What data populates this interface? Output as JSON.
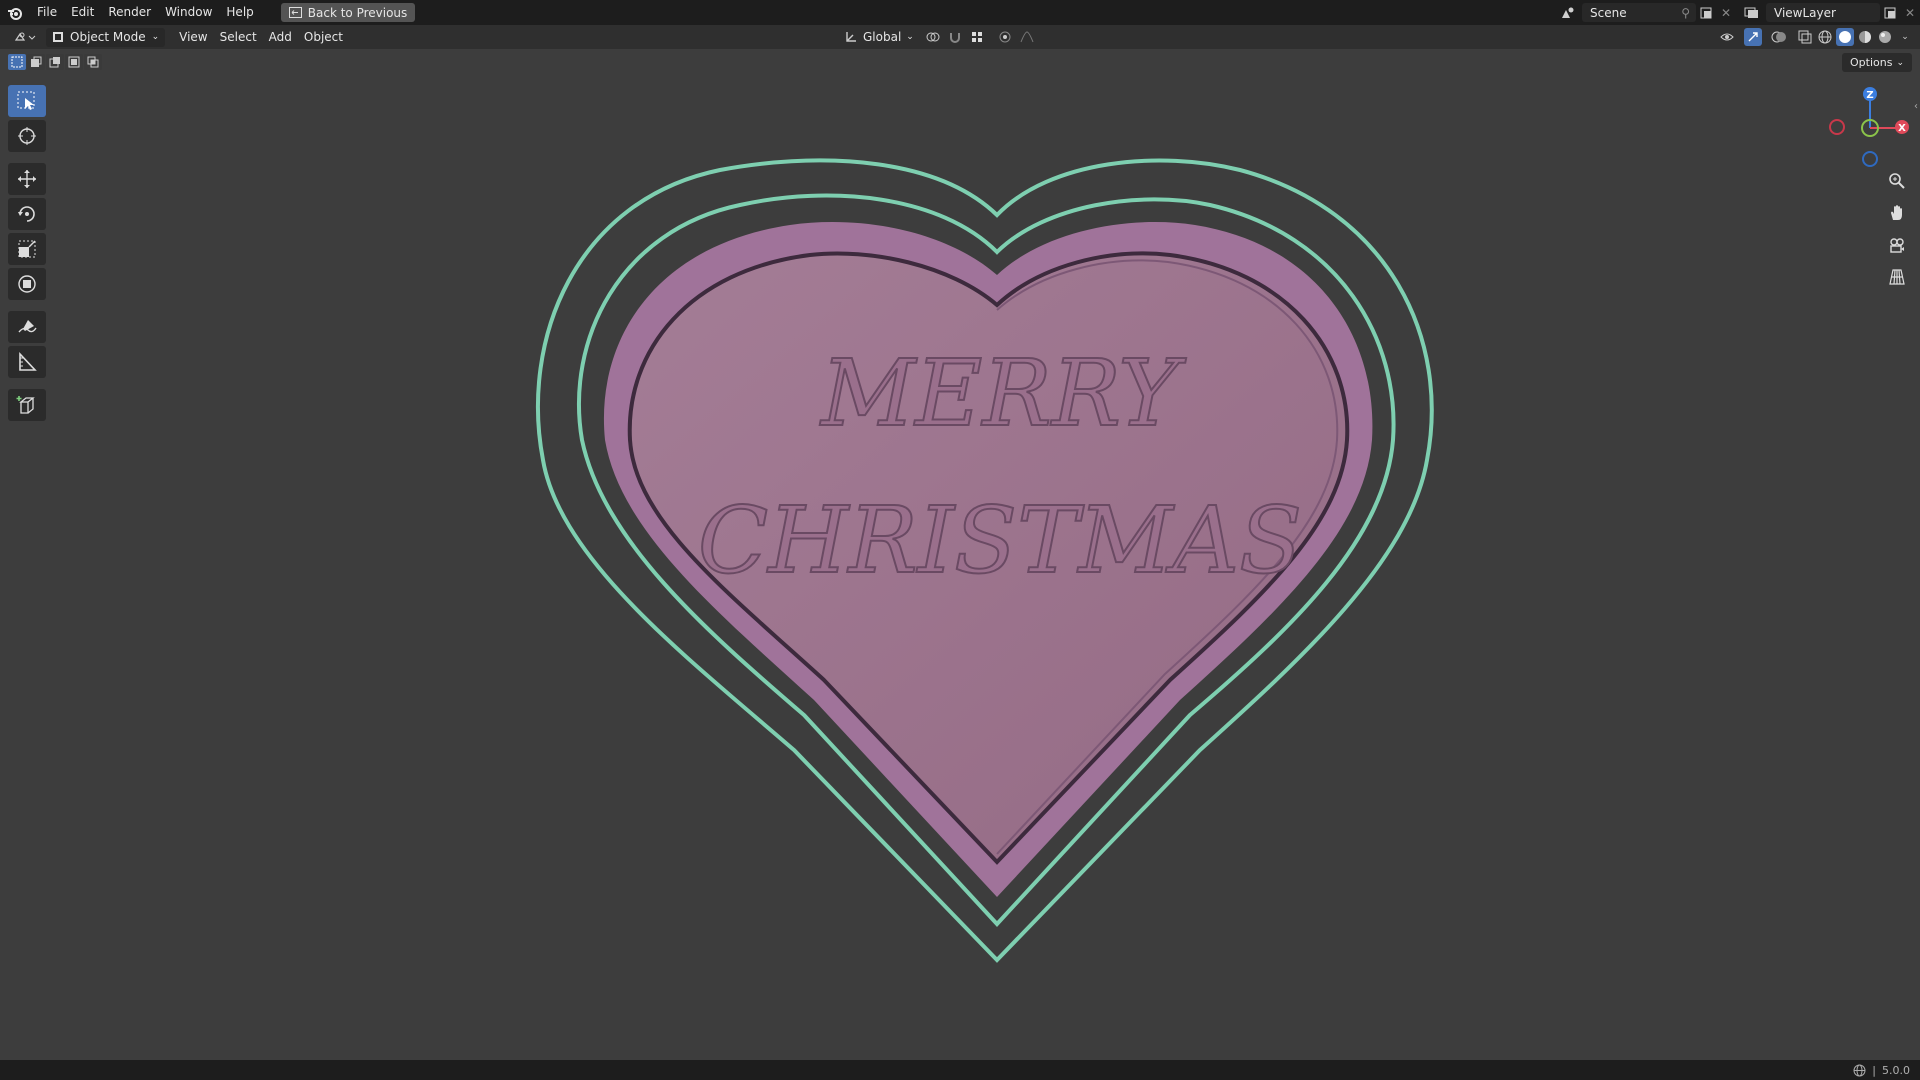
{
  "topbar": {
    "menus": [
      "File",
      "Edit",
      "Render",
      "Window",
      "Help"
    ],
    "back_label": "Back to Previous",
    "scene": "Scene",
    "view_layer": "ViewLayer"
  },
  "viewport_header": {
    "mode": "Object Mode",
    "menus": [
      "View",
      "Select",
      "Add",
      "Object"
    ],
    "transform_orientation": "Global",
    "options": "Options"
  },
  "viewport": {
    "text_line1": "MERRY",
    "text_line2": "CHRISTMAS",
    "colors": {
      "background": "#3d3d3d",
      "heart_fill": "#9a7088",
      "heart_rim": "#a0739a",
      "outline": "#7ecfb0"
    },
    "gizmo_labels": {
      "z": "Z",
      "x": "X"
    }
  },
  "statusbar": {
    "version": "5.0.0"
  }
}
